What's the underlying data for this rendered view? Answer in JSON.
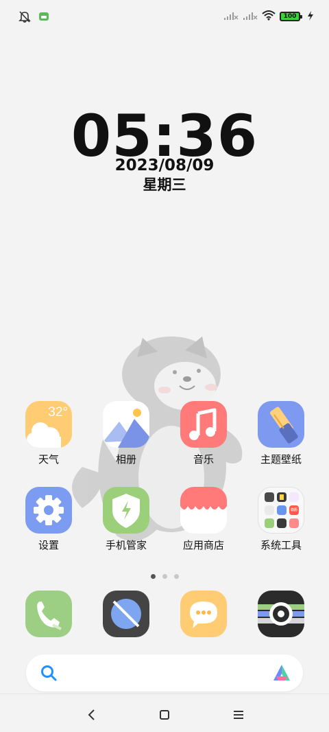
{
  "status_bar": {
    "battery": "100",
    "icons": [
      "bell-off-icon",
      "android-robot-icon",
      "signal-x-icon",
      "signal-x-icon",
      "wifi-icon",
      "battery-icon",
      "charging-bolt-icon"
    ]
  },
  "lock": {
    "time": "05:36",
    "date": "2023/08/09",
    "weekday": "星期三"
  },
  "apps": [
    {
      "label": "天气",
      "icon": "weather-icon",
      "temp": "32°"
    },
    {
      "label": "相册",
      "icon": "gallery-icon"
    },
    {
      "label": "音乐",
      "icon": "music-icon"
    },
    {
      "label": "主题壁纸",
      "icon": "theme-brush-icon"
    },
    {
      "label": "设置",
      "icon": "settings-gear-icon"
    },
    {
      "label": "手机管家",
      "icon": "security-shield-icon"
    },
    {
      "label": "应用商店",
      "icon": "app-store-icon"
    },
    {
      "label": "系统工具",
      "icon": "folder-icon"
    }
  ],
  "folder_preview": {
    "mini_label": "日历"
  },
  "dock": [
    "phone-icon",
    "browser-icon",
    "messages-icon",
    "camera-icon"
  ],
  "page_indicator": {
    "count": 3,
    "active": 1
  },
  "search": {
    "icon": "search-icon",
    "assistant_icon": "assistant-logo-icon"
  },
  "nav": [
    "back-icon",
    "home-icon",
    "menu-icon"
  ],
  "colors": {
    "background": "#f3f3f3",
    "weather": "#ffcc73",
    "music": "#ff7a78",
    "theme": "#7e9af0",
    "settings": "#7b9cf0",
    "security": "#9ccf7a",
    "phone": "#9ccf84",
    "browser": "#444444",
    "messages": "#ffcc73",
    "camera": "#2b2b2b",
    "search_icon": "#1e90ff"
  }
}
